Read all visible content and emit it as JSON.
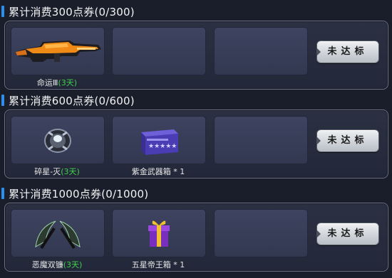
{
  "tiers": [
    {
      "title": "累计消费300点券(0/300)",
      "button": "未达标",
      "rewards": [
        {
          "icon": "orange-rifle-icon",
          "name": "命运Ⅲ",
          "days": "(3天)"
        }
      ]
    },
    {
      "title": "累计消费600点券(0/600)",
      "button": "未达标",
      "rewards": [
        {
          "icon": "gear-orb-icon",
          "name": "碎星-灭",
          "days": "(3天)"
        },
        {
          "icon": "purple-crate-icon",
          "name": "紫金武器箱 * 1",
          "days": ""
        }
      ]
    },
    {
      "title": "累计消费1000点券(0/1000)",
      "button": "未达标",
      "rewards": [
        {
          "icon": "twin-scythe-icon",
          "name": "恶魔双镰",
          "days": "(3天)"
        },
        {
          "icon": "gift-box-icon",
          "name": "五星帝王箱 * 1",
          "days": ""
        }
      ]
    }
  ]
}
